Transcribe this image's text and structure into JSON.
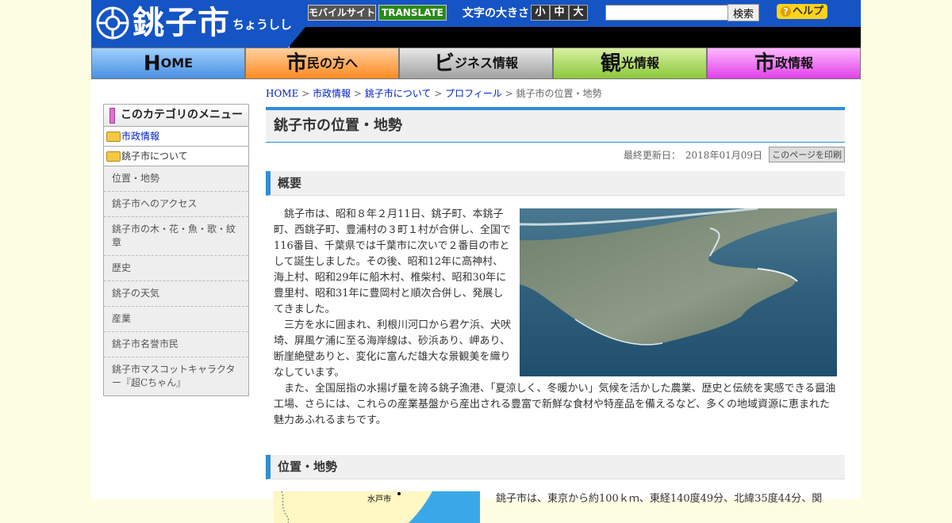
{
  "header": {
    "logo_text": "銚子市",
    "logo_kana": "ちょうしし",
    "mobile_site": "モバイルサイト",
    "translate": "TRANSLATE",
    "font_size_label": "文字の大きさ",
    "font_small": "小",
    "font_medium": "中",
    "font_large": "大",
    "search_placeholder": "",
    "search_button": "検索",
    "help": "ヘルプ",
    "help_icon": "?"
  },
  "nav": {
    "home": {
      "big": "H",
      "rest": "OME"
    },
    "citizens": {
      "big": "市",
      "rest": "民の方へ"
    },
    "business": {
      "big": "ビ",
      "rest": "ジネス情報"
    },
    "tourism": {
      "big": "観",
      "rest": "光情報"
    },
    "city": {
      "big": "市",
      "rest": "政情報"
    }
  },
  "sidebar": {
    "title": "このカテゴリのメニュー",
    "folder_city": "市政情報",
    "folder_about": "銚子市について",
    "items": [
      "位置・地勢",
      "銚子市へのアクセス",
      "銚子市の木・花・魚・歌・紋章",
      "歴史",
      "銚子の天気",
      "産業",
      "銚子市名誉市民",
      "銚子市マスコットキャラクター『超Cちゃん』"
    ]
  },
  "breadcrumb": {
    "home": "HOME",
    "sep": " > ",
    "city": "市政情報",
    "about": "銚子市について",
    "profile": "プロフィール",
    "current": "銚子市の位置・地勢"
  },
  "main": {
    "title": "銚子市の位置・地勢",
    "last_updated": "最終更新日：　2018年01月09日",
    "print": "このページを印刷",
    "section1": "概要",
    "p1": "銚子市は、昭和８年２月11日、銚子町、本銚子町、西銚子町、豊浦村の３町１村が合併し、全国で116番目、千葉県では千葉市に次いで２番目の市として誕生しました。その後、昭和12年に高神村、海上村、昭和29年に船木村、椎柴村、昭和30年に豊里村、昭和31年に豊岡村と順次合併し、発展してきました。",
    "p2": "三方を水に囲まれ、利根川河口から君ケ浜、犬吠埼、屏風ケ浦に至る海岸線は、砂浜あり、岬あり、断崖絶壁ありと、変化に富んだ雄大な景観美を織りなしています。",
    "p3": "また、全国屈指の水揚げ量を誇る銚子漁港、「夏涼しく、冬暖かい」気候を活かした農業、歴史と伝統を実感できる醤油工場、さらには、これらの産業基盤から産出される豊富で新鮮な食材や特産品を備えるなど、多くの地域資源に恵まれた魅力あふれるまちです。",
    "section2": "位置・地勢",
    "map_label": "水戸市",
    "p4": "銚子市は、東京から約100ｋｍ、東経140度49分、北緯35度44分、関"
  }
}
